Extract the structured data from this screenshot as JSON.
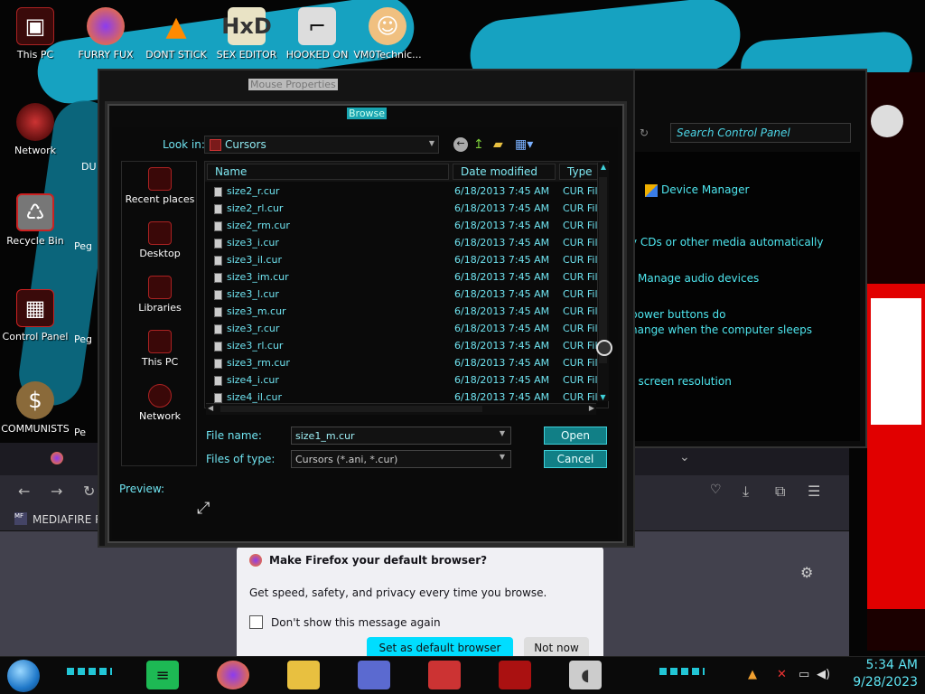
{
  "desktop": {
    "icons_top": [
      {
        "label": "This PC"
      },
      {
        "label": "FURRY FUX"
      },
      {
        "label": "DONT STICK"
      },
      {
        "label": "SEX EDITOR"
      },
      {
        "label": "HOOKED ON"
      },
      {
        "label": "VM0Technic..."
      }
    ],
    "icons_left": [
      {
        "label": "Network"
      },
      {
        "label": "Recycle Bin"
      },
      {
        "label": "Control Panel"
      },
      {
        "label": "COMMUNISTS"
      }
    ],
    "partial_labels": [
      "DU",
      "Peg",
      "Peg",
      "Pe"
    ]
  },
  "mouse_properties": {
    "title": "Mouse Properties"
  },
  "control_panel": {
    "search_placeholder": "Search Control Panel",
    "links": [
      {
        "text": "Device Manager"
      },
      {
        "text": "y CDs or other media automatically"
      },
      {
        "text": "Manage audio devices"
      },
      {
        "text": "power buttons do"
      },
      {
        "text": "hange when the computer sleeps"
      },
      {
        "text": "t screen resolution"
      }
    ]
  },
  "browse": {
    "title": "Browse",
    "look_in_label": "Look in:",
    "look_in_value": "Cursors",
    "places": [
      {
        "label": "Recent places"
      },
      {
        "label": "Desktop"
      },
      {
        "label": "Libraries"
      },
      {
        "label": "This PC"
      },
      {
        "label": "Network"
      }
    ],
    "columns": [
      "Name",
      "Date modified",
      "Type"
    ],
    "files": [
      {
        "name": "size2_r.cur",
        "date": "6/18/2013 7:45 AM",
        "type": "CUR File"
      },
      {
        "name": "size2_rl.cur",
        "date": "6/18/2013 7:45 AM",
        "type": "CUR File"
      },
      {
        "name": "size2_rm.cur",
        "date": "6/18/2013 7:45 AM",
        "type": "CUR File"
      },
      {
        "name": "size3_i.cur",
        "date": "6/18/2013 7:45 AM",
        "type": "CUR File"
      },
      {
        "name": "size3_il.cur",
        "date": "6/18/2013 7:45 AM",
        "type": "CUR File"
      },
      {
        "name": "size3_im.cur",
        "date": "6/18/2013 7:45 AM",
        "type": "CUR File"
      },
      {
        "name": "size3_l.cur",
        "date": "6/18/2013 7:45 AM",
        "type": "CUR File"
      },
      {
        "name": "size3_m.cur",
        "date": "6/18/2013 7:45 AM",
        "type": "CUR File"
      },
      {
        "name": "size3_r.cur",
        "date": "6/18/2013 7:45 AM",
        "type": "CUR File"
      },
      {
        "name": "size3_rl.cur",
        "date": "6/18/2013 7:45 AM",
        "type": "CUR File"
      },
      {
        "name": "size3_rm.cur",
        "date": "6/18/2013 7:45 AM",
        "type": "CUR File"
      },
      {
        "name": "size4_i.cur",
        "date": "6/18/2013 7:45 AM",
        "type": "CUR File"
      },
      {
        "name": "size4_il.cur",
        "date": "6/18/2013 7:45 AM",
        "type": "CUR File"
      }
    ],
    "file_name_label": "File name:",
    "file_name_value": "size1_m.cur",
    "file_type_label": "Files of type:",
    "file_type_value": "Cursors (*.ani, *.cur)",
    "open_label": "Open",
    "cancel_label": "Cancel",
    "preview_label": "Preview:"
  },
  "firefox": {
    "bookmark": "MEDIAFIRE R",
    "banner_title": "Make Firefox your default browser?",
    "banner_text": "Get speed, safety, and privacy every time you browse.",
    "banner_checkbox": "Don't show this message again",
    "banner_primary": "Set as default browser",
    "banner_secondary": "Not now"
  },
  "taskbar": {
    "time": "5:34 AM",
    "date": "9/28/2023"
  }
}
